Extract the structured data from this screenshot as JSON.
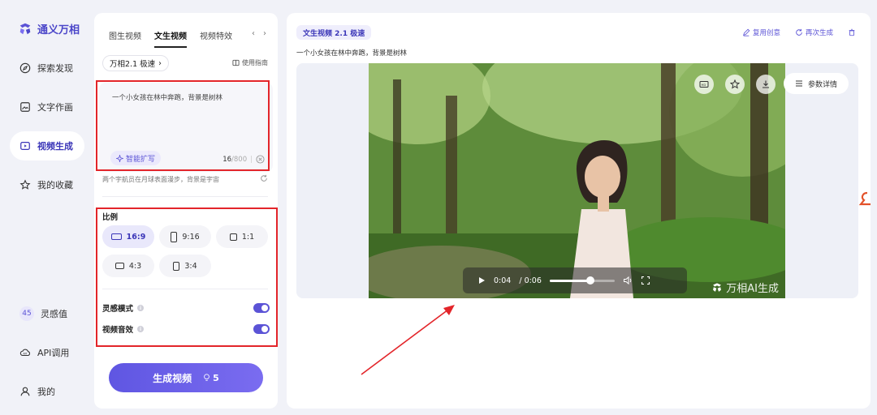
{
  "brand": {
    "name": "通义万相"
  },
  "nav": {
    "items": [
      {
        "label": "探索发现",
        "icon": "compass-icon"
      },
      {
        "label": "文字作画",
        "icon": "image-icon"
      },
      {
        "label": "视频生成",
        "icon": "video-icon",
        "active": true
      },
      {
        "label": "我的收藏",
        "icon": "star-icon"
      }
    ],
    "credits": {
      "value": "45",
      "label": "灵感值"
    },
    "api_label": "API调用",
    "profile_label": "我的"
  },
  "panel": {
    "tabs": [
      "图生视频",
      "文生视频",
      "视频特效"
    ],
    "active_tab": 1,
    "model": "万相2.1 极速",
    "guide": "使用指南",
    "prompt": "一个小女孩在林中奔跑，背景是树林",
    "expand_label": "智能扩写",
    "char_count": "16",
    "char_limit": "/800",
    "suggestion": "两个宇航员在月球表面漫步，背景是宇宙",
    "ratio_title": "比例",
    "ratios": [
      "16:9",
      "9:16",
      "1:1",
      "4:3",
      "3:4"
    ],
    "active_ratio": 0,
    "toggles": [
      {
        "label": "灵感模式",
        "on": true
      },
      {
        "label": "视频音效",
        "on": true
      }
    ],
    "generate_label": "生成视频",
    "generate_cost": "5"
  },
  "result": {
    "model_tag": "文生视频 2.1 极速",
    "actions": [
      "复用创意",
      "再次生成"
    ],
    "prompt": "一个小女孩在林中奔跑，背景是树林",
    "params_label": "参数详情",
    "time_current": "0:04",
    "time_total": "/ 0:06",
    "progress": 0.62,
    "watermark": "万相AI生成"
  },
  "colors": {
    "accent": "#5b53d6",
    "annotation": "#e3252a"
  }
}
